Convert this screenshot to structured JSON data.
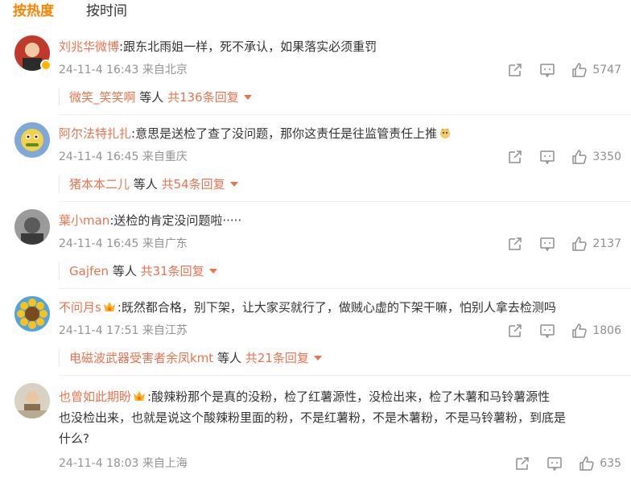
{
  "tabs": {
    "hot": "按热度",
    "time": "按时间"
  },
  "comments": [
    {
      "user": "刘兆华微博",
      "text": ":跟东北雨姐一样，死不承认，如果落实必须重罚",
      "time": "24-11-4 16:43",
      "location": "来自北京",
      "likes": "5747",
      "reply_user": "微笑_笑笑啊",
      "reply_mid": "等人",
      "reply_total": "共136条回复",
      "badge": "verified-badge"
    },
    {
      "user": "阿尔法特扎扎",
      "text": ":意思是送检了查了没问题，那你这责任是往监管责任上推",
      "time": "24-11-4 16:45",
      "location": "来自重庆",
      "likes": "3350",
      "reply_user": "猪本本二儿",
      "reply_mid": "等人",
      "reply_total": "共54条回复",
      "emoji": "doge-emoji"
    },
    {
      "user": "葉小man",
      "text": ":送检的肯定没问题啦·····",
      "time": "24-11-4 16:45",
      "location": "来自广东",
      "likes": "2137",
      "reply_user": "Gajfen",
      "reply_mid": "等人",
      "reply_total": "共31条回复"
    },
    {
      "user": "不问月s",
      "text": ":既然都合格，别下架，让大家买就行了，做贼心虚的下架干嘛，怕别人拿去检测吗",
      "time": "24-11-4 17:51",
      "location": "来自江苏",
      "likes": "1806",
      "reply_user": "电磁波武器受害者余凤kmt",
      "reply_mid": "等人",
      "reply_total": "共21条回复",
      "badge": "crown-icon"
    },
    {
      "user": "也曾如此期盼",
      "text_line1": ":酸辣粉那个是真的没粉，检了红薯源性，没检出来，检了木薯和马铃薯源性",
      "text_line2": "也没检出来，也就是说这个酸辣粉里面的粉，不是红薯粉，不是木薯粉，不是马铃薯粉，到底是",
      "text_line3": "什么?",
      "time": "24-11-4 18:03",
      "location": "来自上海",
      "likes": "635",
      "badge": "crown-icon"
    }
  ],
  "colors": {
    "accent": "#ff8200",
    "username": "#eb7350",
    "meta": "#939393"
  }
}
